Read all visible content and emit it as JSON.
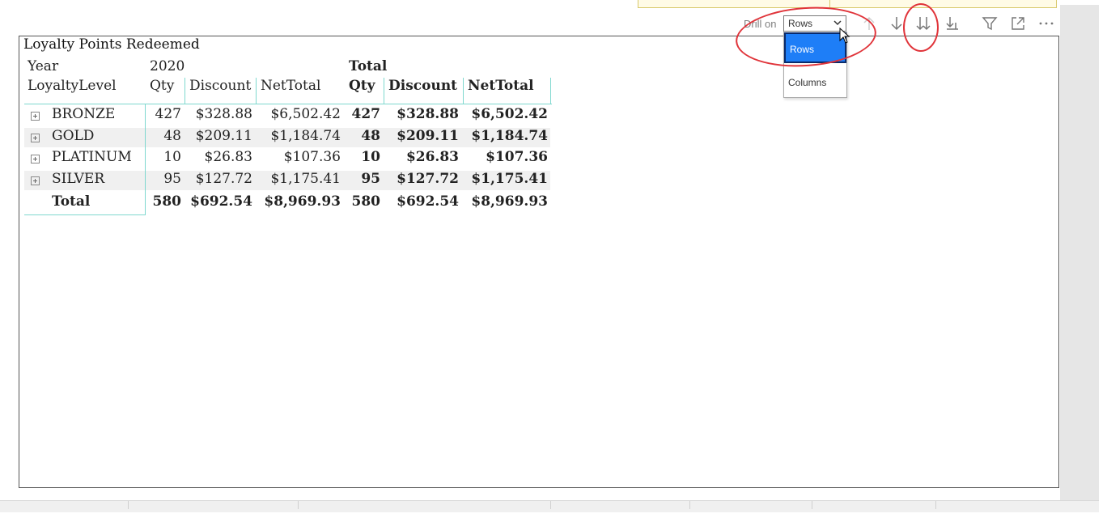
{
  "visual": {
    "title": "Loyalty Points Redeemed"
  },
  "toolbar": {
    "drill_label": "Drill on",
    "drill_selected": "Rows",
    "drill_options": [
      "Rows",
      "Columns"
    ],
    "icons": [
      "drill-up-icon",
      "drill-down-icon",
      "expand-next-level-icon",
      "expand-all-icon",
      "filter-icon",
      "focus-mode-icon",
      "more-options-icon"
    ]
  },
  "matrix": {
    "col_header_row1": {
      "label": "Year",
      "year": "2020",
      "total": "Total"
    },
    "col_header_row2": {
      "row_label": "LoyaltyLevel",
      "cols": [
        "Qty",
        "Discount",
        "NetTotal",
        "Qty",
        "Discount",
        "NetTotal"
      ]
    },
    "rows": [
      {
        "level": "BRONZE",
        "values": [
          "427",
          "$328.88",
          "$6,502.42",
          "427",
          "$328.88",
          "$6,502.42"
        ]
      },
      {
        "level": "GOLD",
        "values": [
          "48",
          "$209.11",
          "$1,184.74",
          "48",
          "$209.11",
          "$1,184.74"
        ]
      },
      {
        "level": "PLATINUM",
        "values": [
          "10",
          "$26.83",
          "$107.36",
          "10",
          "$26.83",
          "$107.36"
        ]
      },
      {
        "level": "SILVER",
        "values": [
          "95",
          "$127.72",
          "$1,175.41",
          "95",
          "$127.72",
          "$1,175.41"
        ]
      }
    ],
    "total_row": {
      "label": "Total",
      "values": [
        "580",
        "$692.54",
        "$8,969.93",
        "580",
        "$692.54",
        "$8,969.93"
      ]
    }
  },
  "colors": {
    "accent": "#1e7ef7",
    "grid_line": "#7fd8cf",
    "annotation": "#e0343a"
  }
}
